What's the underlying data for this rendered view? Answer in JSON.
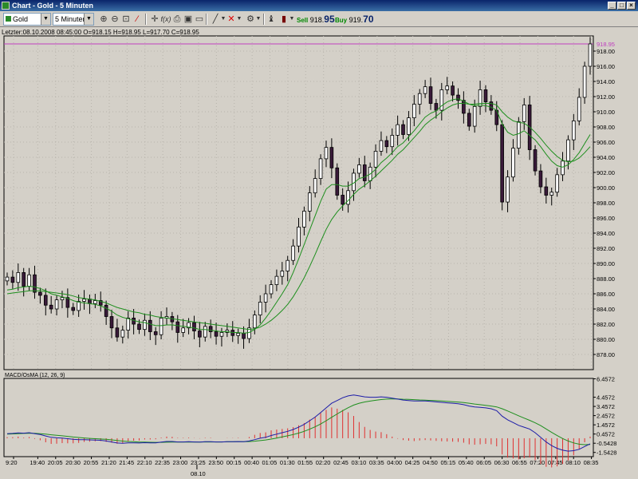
{
  "window": {
    "title": "Chart - Gold - 5 Minuten",
    "min": "_",
    "max": "□",
    "close": "×"
  },
  "toolbar": {
    "symbol": "Gold",
    "interval": "5 Minuten",
    "sell_label": "Sell",
    "sell_small": "918.",
    "sell_big": "95",
    "buy_label": "Buy",
    "buy_small": "919.",
    "buy_big": "70"
  },
  "info": {
    "text": "Letzter:08.10.2008 08:45:00 O=918.15 H=918.95 L=917.70 C=918.95"
  },
  "macd_label": "MACD/OsMA (12, 26, 9)",
  "current_price": "918.95",
  "date_label": "08.10",
  "colors": {
    "bull": "#ffffff",
    "bear": "#3a1a3a",
    "ma_fast": "#1e8f1e",
    "ma_slow": "#1e8f1e",
    "macd": "#1c1ca8",
    "signal": "#1e8f1e",
    "hist": "#e03030",
    "price_line": "#c040c0"
  },
  "chart_data": {
    "type": "candlestick",
    "symbol": "Gold",
    "interval": "5 Minuten",
    "ylim": [
      876,
      920
    ],
    "y_ticks": [
      "918.00",
      "916.00",
      "914.00",
      "912.00",
      "910.00",
      "908.00",
      "906.00",
      "904.00",
      "902.00",
      "900.00",
      "898.00",
      "896.00",
      "894.00",
      "892.00",
      "890.00",
      "888.00",
      "886.00",
      "884.00",
      "882.00",
      "880.00",
      "878.00"
    ],
    "x_ticks": [
      "9:20",
      "19:40",
      "20:05",
      "20:30",
      "20:55",
      "21:20",
      "21:45",
      "22:10",
      "22:35",
      "23:00",
      "23:25",
      "23:50",
      "00:15",
      "00:40",
      "01:05",
      "01:30",
      "01:55",
      "02:20",
      "02:45",
      "03:10",
      "03:35",
      "04:00",
      "04:25",
      "04:50",
      "05:15",
      "05:40",
      "06:05",
      "06:30",
      "06:55",
      "07:20",
      "07:45",
      "08:10",
      "08:35"
    ],
    "macd_ticks": [
      "6.4572",
      "4.4572",
      "3.4572",
      "2.4572",
      "1.4572",
      "0.4572",
      "-0.5428",
      "-1.5428"
    ],
    "macd_ylim": [
      -2.0,
      6.5
    ],
    "closes": [
      888.2,
      887.5,
      888.8,
      887.0,
      888.5,
      886.2,
      885.8,
      884.5,
      884.0,
      885.2,
      885.5,
      884.2,
      883.8,
      885.0,
      885.3,
      884.7,
      885.1,
      884.5,
      883.0,
      881.5,
      880.3,
      881.2,
      882.8,
      882.0,
      881.3,
      882.5,
      881.0,
      880.6,
      882.8,
      883.0,
      882.3,
      880.9,
      881.5,
      882.2,
      881.1,
      880.3,
      881.7,
      881.0,
      880.4,
      880.9,
      881.2,
      880.5,
      880.8,
      880.1,
      881.5,
      883.2,
      884.9,
      886.0,
      887.2,
      888.3,
      889.0,
      890.4,
      892.3,
      894.8,
      896.9,
      899.3,
      901.2,
      903.8,
      905.3,
      902.6,
      899.0,
      897.8,
      899.6,
      901.9,
      903.0,
      900.9,
      902.7,
      904.8,
      906.2,
      905.4,
      906.9,
      908.3,
      907.0,
      909.2,
      911.0,
      912.4,
      913.3,
      911.1,
      910.2,
      912.9,
      913.4,
      912.2,
      911.5,
      909.8,
      908.1,
      910.7,
      912.9,
      911.3,
      910.2,
      908.3,
      898.1,
      901.4,
      905.2,
      908.7,
      910.9,
      905.0,
      902.2,
      900.1,
      899.0,
      899.4,
      901.7,
      903.5,
      906.3,
      908.8,
      911.9,
      916.0,
      918.95
    ],
    "ma_fast": [
      886.5,
      886.6,
      886.8,
      886.9,
      887.0,
      886.9,
      886.7,
      886.4,
      886.0,
      885.8,
      885.6,
      885.4,
      885.1,
      884.9,
      884.8,
      884.7,
      884.6,
      884.4,
      884.1,
      883.7,
      883.2,
      882.9,
      882.7,
      882.5,
      882.3,
      882.2,
      882.0,
      881.8,
      881.8,
      881.9,
      881.9,
      881.8,
      881.7,
      881.6,
      881.5,
      881.3,
      881.3,
      881.2,
      881.1,
      881.0,
      881.0,
      880.9,
      880.9,
      880.8,
      880.9,
      881.3,
      881.9,
      882.8,
      883.8,
      884.9,
      886.0,
      887.2,
      888.8,
      890.6,
      892.5,
      894.4,
      896.3,
      898.2,
      899.8,
      900.4,
      900.4,
      900.2,
      900.2,
      900.6,
      901.2,
      901.4,
      901.8,
      902.4,
      903.3,
      903.9,
      904.6,
      905.4,
      905.9,
      906.7,
      907.5,
      908.4,
      909.3,
      909.8,
      910.1,
      910.8,
      911.3,
      911.6,
      911.7,
      911.4,
      911.0,
      910.8,
      910.9,
      910.8,
      910.6,
      910.2,
      908.4,
      907.3,
      906.9,
      907.1,
      907.5,
      906.9,
      906.3,
      905.4,
      904.4,
      903.5,
      902.9,
      902.7,
      903.0,
      903.7,
      904.6,
      905.8,
      907.0
    ],
    "ma_slow": [
      886.0,
      886.1,
      886.2,
      886.3,
      886.4,
      886.4,
      886.4,
      886.3,
      886.2,
      886.1,
      886.0,
      885.9,
      885.7,
      885.5,
      885.4,
      885.3,
      885.2,
      885.0,
      884.8,
      884.5,
      884.2,
      884.0,
      883.8,
      883.6,
      883.5,
      883.3,
      883.2,
      883.0,
      882.9,
      882.8,
      882.7,
      882.6,
      882.5,
      882.4,
      882.3,
      882.2,
      882.1,
      882.0,
      881.9,
      881.8,
      881.7,
      881.6,
      881.5,
      881.4,
      881.3,
      881.4,
      881.6,
      882.0,
      882.5,
      883.1,
      883.8,
      884.6,
      885.6,
      886.8,
      888.1,
      889.6,
      891.2,
      892.9,
      894.5,
      895.8,
      896.8,
      897.6,
      898.3,
      899.1,
      899.8,
      900.3,
      900.9,
      901.5,
      902.2,
      902.9,
      903.6,
      904.4,
      905.0,
      905.8,
      906.6,
      907.4,
      908.3,
      908.9,
      909.4,
      910.0,
      910.5,
      910.9,
      911.1,
      911.1,
      911.0,
      911.0,
      911.1,
      911.1,
      911.1,
      910.9,
      910.0,
      909.3,
      908.8,
      908.6,
      908.5,
      908.0,
      907.3,
      906.5,
      905.6,
      904.8,
      904.1,
      903.6,
      903.4,
      903.5,
      903.9,
      904.6,
      905.4
    ],
    "macd": [
      0.5,
      0.52,
      0.58,
      0.55,
      0.6,
      0.5,
      0.4,
      0.25,
      0.1,
      0.05,
      0.02,
      -0.05,
      -0.12,
      -0.15,
      -0.15,
      -0.18,
      -0.2,
      -0.22,
      -0.3,
      -0.4,
      -0.52,
      -0.55,
      -0.5,
      -0.5,
      -0.52,
      -0.48,
      -0.5,
      -0.5,
      -0.42,
      -0.35,
      -0.35,
      -0.4,
      -0.4,
      -0.38,
      -0.4,
      -0.42,
      -0.38,
      -0.38,
      -0.4,
      -0.4,
      -0.38,
      -0.38,
      -0.36,
      -0.38,
      -0.3,
      -0.15,
      0.0,
      0.1,
      0.3,
      0.45,
      0.6,
      0.75,
      0.95,
      1.2,
      1.5,
      1.9,
      2.3,
      2.8,
      3.3,
      3.8,
      4.1,
      4.4,
      4.6,
      4.7,
      4.6,
      4.5,
      4.45,
      4.45,
      4.5,
      4.45,
      4.35,
      4.25,
      4.15,
      4.1,
      4.05,
      4.05,
      4.05,
      4.0,
      3.95,
      3.9,
      3.85,
      3.8,
      3.75,
      3.65,
      3.5,
      3.4,
      3.35,
      3.3,
      3.2,
      3.0,
      2.4,
      2.0,
      1.7,
      1.4,
      1.2,
      1.0,
      0.6,
      0.1,
      -0.4,
      -0.8,
      -1.1,
      -1.3,
      -1.4,
      -1.35,
      -1.2,
      -0.9,
      -0.6
    ],
    "signal": [
      0.45,
      0.47,
      0.5,
      0.52,
      0.54,
      0.53,
      0.5,
      0.45,
      0.38,
      0.32,
      0.26,
      0.2,
      0.13,
      0.08,
      0.03,
      -0.01,
      -0.05,
      -0.08,
      -0.12,
      -0.18,
      -0.25,
      -0.31,
      -0.35,
      -0.38,
      -0.41,
      -0.42,
      -0.44,
      -0.45,
      -0.45,
      -0.43,
      -0.42,
      -0.42,
      -0.42,
      -0.41,
      -0.41,
      -0.41,
      -0.4,
      -0.4,
      -0.4,
      -0.4,
      -0.39,
      -0.39,
      -0.38,
      -0.38,
      -0.36,
      -0.32,
      -0.26,
      -0.19,
      -0.09,
      0.02,
      0.14,
      0.26,
      0.4,
      0.56,
      0.75,
      0.98,
      1.24,
      1.55,
      1.9,
      2.28,
      2.64,
      3.0,
      3.32,
      3.6,
      3.8,
      3.94,
      4.04,
      4.12,
      4.2,
      4.25,
      4.27,
      4.27,
      4.24,
      4.22,
      4.19,
      4.16,
      4.14,
      4.11,
      4.08,
      4.05,
      4.01,
      3.97,
      3.93,
      3.87,
      3.8,
      3.72,
      3.65,
      3.58,
      3.5,
      3.4,
      3.2,
      2.96,
      2.7,
      2.44,
      2.19,
      1.95,
      1.68,
      1.37,
      1.01,
      0.64,
      0.29,
      -0.03,
      -0.3,
      -0.51,
      -0.65,
      -0.7,
      -0.68
    ]
  }
}
